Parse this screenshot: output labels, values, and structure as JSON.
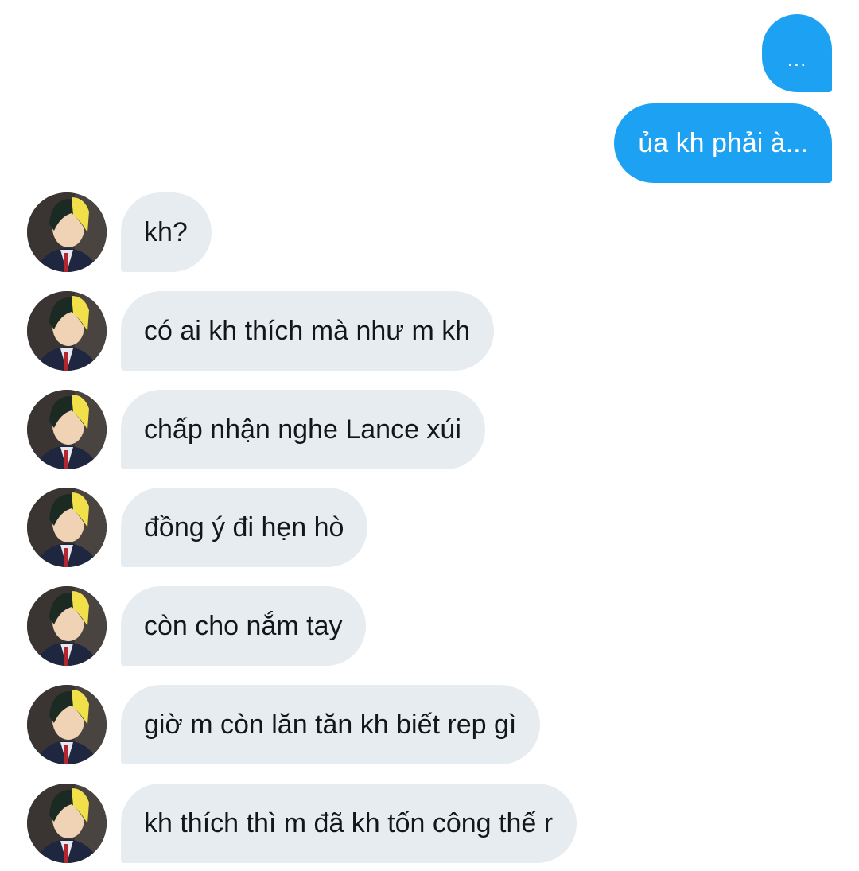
{
  "colors": {
    "outgoing_bubble": "#1da1f2",
    "incoming_bubble": "#e6ecf0",
    "outgoing_text": "#ffffff",
    "incoming_text": "#14171a"
  },
  "outgoing": [
    {
      "text": "..."
    },
    {
      "text": "ủa kh phải à..."
    }
  ],
  "incoming": [
    {
      "text": "kh?"
    },
    {
      "text": "có ai kh thích mà như m kh"
    },
    {
      "text": "chấp nhận nghe Lance xúi"
    },
    {
      "text": "đồng ý đi hẹn hò"
    },
    {
      "text": "còn cho nắm tay"
    },
    {
      "text": "giờ m còn lăn tăn kh biết rep gì"
    },
    {
      "text": "kh thích thì m đã kh tốn công thế r"
    }
  ]
}
